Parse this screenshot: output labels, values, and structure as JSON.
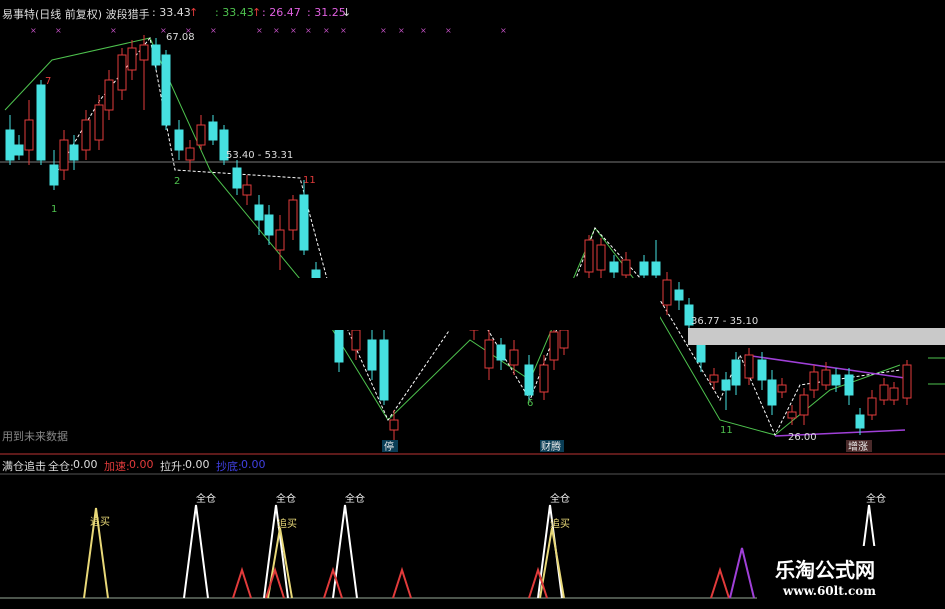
{
  "header": {
    "title": "易事特(日线 前复权) 波段猎手",
    "v1": ": 33.43",
    "v2": ": 33.43",
    "v3": ": 26.47",
    "v4": ": 31.25",
    "arrow1": "↑",
    "arrow2": "↑",
    "arrow3": "↓"
  },
  "price_labels": {
    "high": "67.08",
    "range1": "53.40 - 53.31",
    "range2": "36.77 - 35.10",
    "low": "26.00"
  },
  "wave_labels": [
    "7",
    "1",
    "2",
    "11",
    "6",
    "11"
  ],
  "markers": {
    "m1": "停",
    "m2": "财腾",
    "m3": "增涨"
  },
  "note": "用到未来数据",
  "sub_header": {
    "name": "满仓追击",
    "items": [
      {
        "label": "全仓:",
        "value": "0.00"
      },
      {
        "label": "加速:",
        "value": "0.00"
      },
      {
        "label": "拉升:",
        "value": "0.00"
      },
      {
        "label": "抄底:",
        "value": "0.00"
      }
    ]
  },
  "signals": [
    "全仓",
    "全仓",
    "全仓",
    "全仓",
    "全仓",
    "追买",
    "追买",
    "追买"
  ],
  "logo": {
    "name": "乐淘公式网",
    "url": "www.60lt.com"
  },
  "colors": {
    "up": "#e23b3b",
    "down": "#46e0e0",
    "green_line": "#4ec24e",
    "white_line": "#ffffff",
    "purple_line": "#a040d8"
  }
}
